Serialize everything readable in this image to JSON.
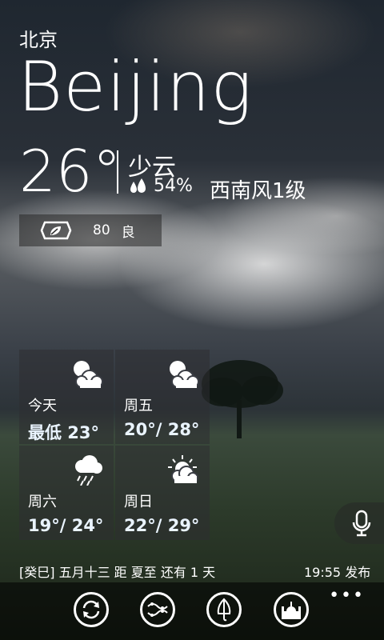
{
  "location": {
    "name_cn": "北京",
    "name_en": "Beijing"
  },
  "current": {
    "temperature": "26°",
    "condition": "少云",
    "humidity": "54%",
    "wind": "西南风1级"
  },
  "air_quality": {
    "value": "80",
    "level": "良",
    "icon": "mask-leaf-icon"
  },
  "forecast": [
    {
      "day": "今天",
      "temp": "最低 23°",
      "icon": "partly-cloudy-icon"
    },
    {
      "day": "周五",
      "temp": "20°/ 28°",
      "icon": "partly-cloudy-icon"
    },
    {
      "day": "周六",
      "temp": "19°/ 24°",
      "icon": "rain-cloud-icon"
    },
    {
      "day": "周日",
      "temp": "22°/ 29°",
      "icon": "sun-behind-cloud-icon"
    }
  ],
  "footer": {
    "lunar_info": "[癸巳] 五月十三  距 夏至 还有 1 天",
    "publish_time": "19:55 发布"
  },
  "app_bar": {
    "buttons": [
      "refresh-icon",
      "trend-icon",
      "umbrella-icon",
      "city-icon"
    ],
    "more": "•••"
  }
}
